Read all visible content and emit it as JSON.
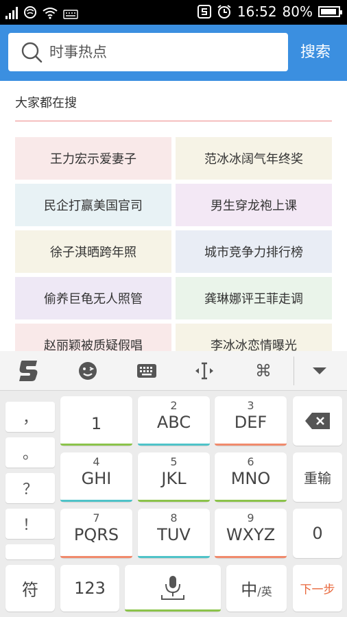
{
  "status_bar": {
    "time": "16:52",
    "battery": "80%"
  },
  "search": {
    "placeholder": "时事热点",
    "button_label": "搜索"
  },
  "section_title": "大家都在搜",
  "hot_searches": [
    {
      "label": "王力宏示爱妻子",
      "color": "#f9e9e9"
    },
    {
      "label": "范冰冰阔气年终奖",
      "color": "#f6f3e6"
    },
    {
      "label": "民企打赢美国官司",
      "color": "#e8f2f5"
    },
    {
      "label": "男生穿龙袍上课",
      "color": "#f3e8f5"
    },
    {
      "label": "徐子淇晒跨年照",
      "color": "#f6f3e6"
    },
    {
      "label": "城市竞争力排行榜",
      "color": "#e9edf5"
    },
    {
      "label": "偷养巨龟无人照管",
      "color": "#eee8f5"
    },
    {
      "label": "龚琳娜评王菲走调",
      "color": "#eaf4ea"
    },
    {
      "label": "赵丽颖被质疑假唱",
      "color": "#f9e9e9"
    },
    {
      "label": "李冰冰恋情曝光",
      "color": "#f6f3e6"
    }
  ],
  "keyboard": {
    "toolbar": [
      "sogou-logo-icon",
      "emoji-icon",
      "keyboard-icon",
      "cursor-icon",
      "command-icon",
      "collapse-icon"
    ],
    "punctuation": [
      "，",
      "。",
      "？",
      "！"
    ],
    "keys": [
      {
        "sub": "",
        "main": "1",
        "accent": "#8bc34a"
      },
      {
        "sub": "2",
        "main": "ABC",
        "accent": "#4fc3c8"
      },
      {
        "sub": "3",
        "main": "DEF",
        "accent": "#f08a6c"
      },
      {
        "sub": "4",
        "main": "GHI",
        "accent": "#4fc3c8"
      },
      {
        "sub": "5",
        "main": "JKL",
        "accent": "#8bc34a"
      },
      {
        "sub": "6",
        "main": "MNO",
        "accent": "#8bc34a"
      },
      {
        "sub": "7",
        "main": "PQRS",
        "accent": "#f08a6c"
      },
      {
        "sub": "8",
        "main": "TUV",
        "accent": "#4fc3c8"
      },
      {
        "sub": "9",
        "main": "WXYZ",
        "accent": "#f08a6c"
      }
    ],
    "reenter": "重输",
    "zero": "0",
    "symbol": "符",
    "num": "123",
    "lang_main": "中",
    "lang_sub": "/英",
    "next": "下一步",
    "next_color": "#e8673b",
    "space_accent": "#8bc34a"
  }
}
